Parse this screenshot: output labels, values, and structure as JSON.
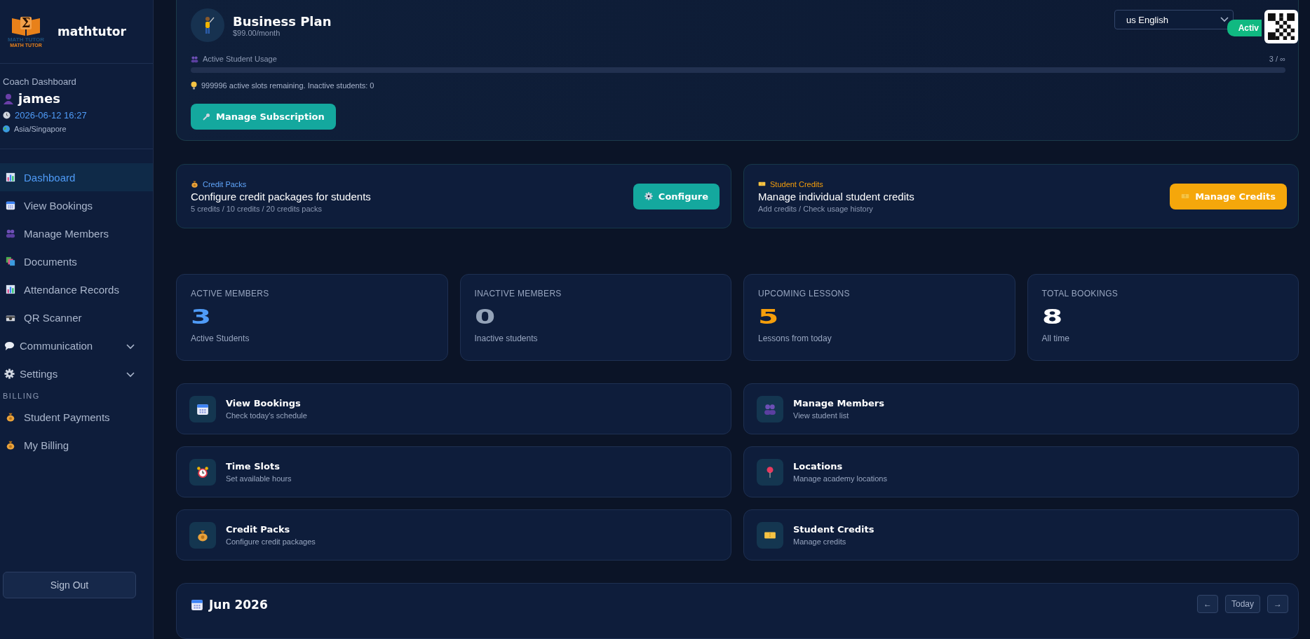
{
  "sidebar": {
    "logo": {
      "symbol": "Σ",
      "caption": "MATH TUTOR",
      "subcaption": "MATH TUTOR"
    },
    "brand": "mathtutor",
    "profile": {
      "role": "Coach Dashboard",
      "name": "james",
      "datetime": "2026-06-12 16:27",
      "timezone": "Asia/Singapore"
    },
    "items": [
      {
        "label": "Dashboard",
        "selected": true
      },
      {
        "label": "View Bookings",
        "selected": false
      },
      {
        "label": "Manage Members",
        "selected": false
      },
      {
        "label": "Documents",
        "selected": false
      },
      {
        "label": "Attendance Records",
        "selected": false
      },
      {
        "label": "QR Scanner",
        "selected": false
      },
      {
        "label": "Communication",
        "selected": false,
        "kind": "group",
        "expanded": false
      },
      {
        "label": "Settings",
        "selected": false,
        "kind": "group",
        "expanded": false
      }
    ],
    "billing": {
      "heading": "BILLING",
      "items": [
        {
          "label": "Student Payments",
          "selected": false
        },
        {
          "label": "My Billing",
          "selected": false
        }
      ]
    },
    "sign_out": "Sign Out"
  },
  "language": "us English",
  "plan": {
    "title": "Business Plan",
    "price": "$99.00/month",
    "status": "Activ",
    "usage_label": "Active Student Usage",
    "usage_value": "3 / ∞",
    "usage": {
      "level": 0
    },
    "note": "999996 active slots remaining. Inactive students: 0",
    "button": "Manage Subscription"
  },
  "promos": [
    {
      "tag": "Credit Packs",
      "color": "#60a5fa",
      "title": "Configure credit packages for students",
      "subtitle": "5 credits / 10 credits / 20 credits packs",
      "button": "Configure"
    },
    {
      "tag": "Student Credits",
      "color": "#f59e0b",
      "title": "Manage individual student credits",
      "subtitle": "Add credits / Check usage history",
      "button": "Manage Credits"
    }
  ],
  "stats": [
    {
      "label": "ACTIVE MEMBERS",
      "value": "3",
      "color": "#4f9bf7",
      "caption": "Active Students"
    },
    {
      "label": "INACTIVE MEMBERS",
      "value": "0",
      "color": "#94a3b8",
      "caption": "Inactive students"
    },
    {
      "label": "UPCOMING LESSONS",
      "value": "5",
      "color": "#f59e0b",
      "caption": "Lessons from today"
    },
    {
      "label": "TOTAL BOOKINGS",
      "value": "8",
      "color": "#ffffff",
      "caption": "All time"
    }
  ],
  "quick_links": [
    {
      "title": "View Bookings",
      "subtitle": "Check today's schedule"
    },
    {
      "title": "Manage Members",
      "subtitle": "View student list"
    },
    {
      "title": "Time Slots",
      "subtitle": "Set available hours"
    },
    {
      "title": "Locations",
      "subtitle": "Manage academy locations"
    },
    {
      "title": "Credit Packs",
      "subtitle": "Configure credit packages"
    },
    {
      "title": "Student Credits",
      "subtitle": "Manage credits"
    }
  ],
  "calendar": {
    "title": "Jun 2026",
    "prev": "←",
    "today": "Today",
    "next": "→"
  }
}
